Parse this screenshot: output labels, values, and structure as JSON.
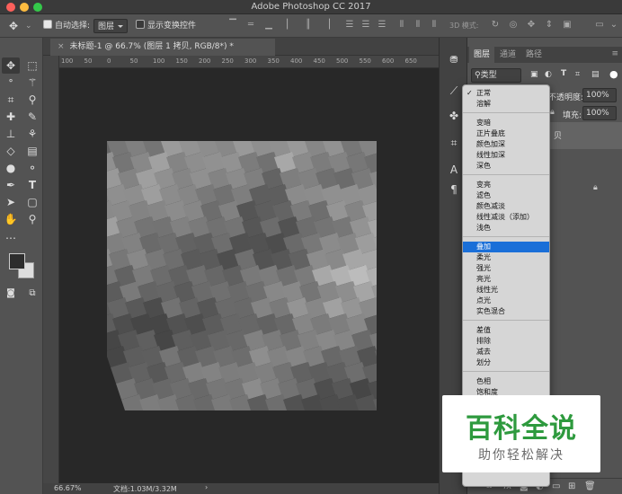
{
  "window": {
    "title": "Adobe Photoshop CC 2017"
  },
  "options_bar": {
    "auto_select_label": "自动选择:",
    "auto_select_value": "图层",
    "show_transform_label": "显示变换控件",
    "mode_3d_label": "3D 模式:"
  },
  "document": {
    "tab_title": "未标题-1 @ 66.7% (图层 1 拷贝, RGB/8*) *",
    "zoom": "66.67%",
    "doc_info": "文档:1.03M/3.32M"
  },
  "ruler": {
    "labels": [
      "100",
      "50",
      "0",
      "50",
      "100",
      "150",
      "200",
      "250",
      "300",
      "350",
      "400",
      "450",
      "500",
      "550",
      "600",
      "650"
    ]
  },
  "layers_panel": {
    "tabs": [
      "图层",
      "通道",
      "路径"
    ],
    "filter_label": "类型",
    "opacity_label": "不透明度:",
    "opacity_value": "100%",
    "fill_label": "填充:",
    "fill_value": "100%"
  },
  "blend_menu": {
    "groups": [
      [
        "正常",
        "溶解"
      ],
      [
        "变暗",
        "正片叠底",
        "颜色加深",
        "线性加深",
        "深色"
      ],
      [
        "变亮",
        "滤色",
        "颜色减淡",
        "线性减淡（添加）",
        "浅色"
      ],
      [
        "叠加",
        "柔光",
        "强光",
        "亮光",
        "线性光",
        "点光",
        "实色混合"
      ],
      [
        "差值",
        "排除",
        "减去",
        "划分"
      ],
      [
        "色相",
        "饱和度"
      ]
    ],
    "checked": "正常",
    "highlighted": "叠加"
  },
  "watermark": {
    "title": "百科全说",
    "subtitle": "助你轻松解决"
  },
  "colors": {
    "highlight": "#1a6fd8",
    "watermark_green": "#2e9a3e"
  },
  "icons": [
    "move-icon",
    "marquee-icon",
    "lasso-icon",
    "magic-wand-icon",
    "crop-icon",
    "eyedropper-icon",
    "healing-icon",
    "brush-icon",
    "stamp-icon",
    "history-brush-icon",
    "eraser-icon",
    "gradient-icon",
    "blur-icon",
    "dodge-icon",
    "pen-icon",
    "type-icon",
    "path-select-icon",
    "shape-icon",
    "hand-icon",
    "zoom-icon",
    "more-icon"
  ]
}
